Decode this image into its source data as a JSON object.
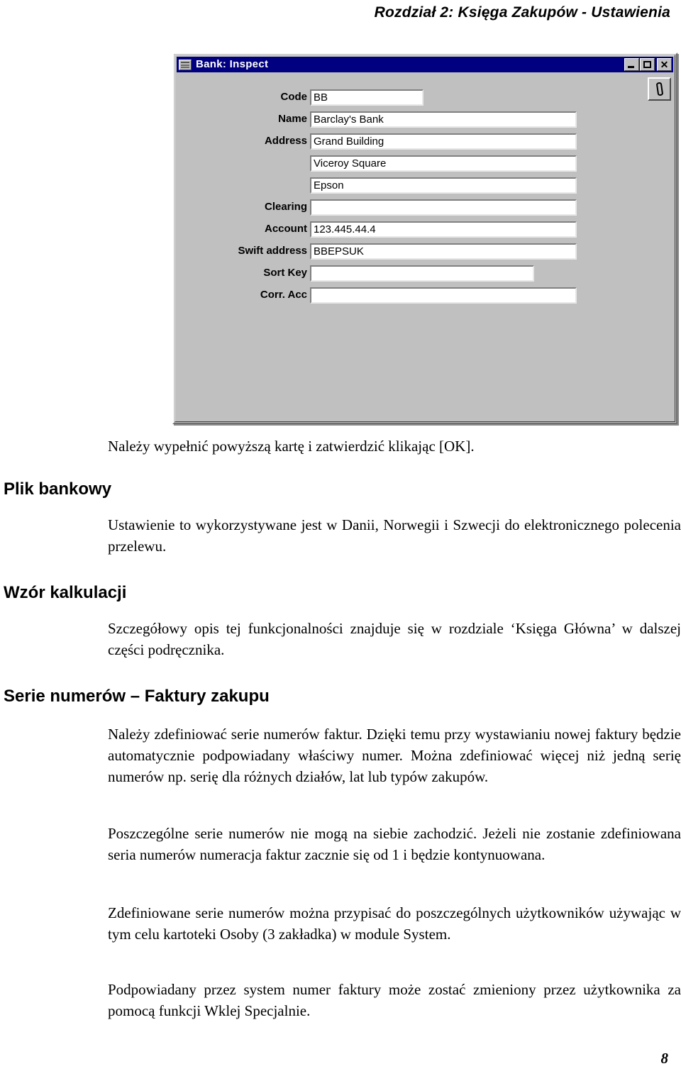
{
  "header": {
    "running_title": "Rozdział 2: Księga Zakupów - Ustawienia"
  },
  "dialog": {
    "title": "Bank: Inspect",
    "title_icon": "window-document-icon",
    "window_buttons": {
      "minimize": "_",
      "maximize": "□",
      "close": "✕"
    },
    "attachment_button_icon": "paperclip-icon",
    "fields": [
      {
        "label": "Code",
        "value": "BB",
        "width": "code"
      },
      {
        "label": "Name",
        "value": "Barclay's Bank",
        "width": "full"
      },
      {
        "label": "Address",
        "value": "Grand Building",
        "width": "full"
      },
      {
        "label": "",
        "value": "Viceroy Square",
        "width": "full"
      },
      {
        "label": "",
        "value": "Epson",
        "width": "full"
      },
      {
        "label": "Clearing",
        "value": "",
        "width": "full"
      },
      {
        "label": "Account",
        "value": "123.445.44.4",
        "width": "full"
      },
      {
        "label": "Swift address",
        "value": "BBEPSUK",
        "width": "full"
      },
      {
        "label": "Sort Key",
        "value": "",
        "width": "sort"
      },
      {
        "label": "Corr. Acc",
        "value": "",
        "width": "full"
      }
    ]
  },
  "content": {
    "caption": "Należy wypełnić powyższą kartę i zatwierdzić klikając [OK].",
    "section1_heading": "Plik bankowy",
    "section1_text": "Ustawienie to wykorzystywane jest w Danii, Norwegii i Szwecji do elektronicznego polecenia przelewu.",
    "section2_heading": "Wzór kalkulacji",
    "section2_text": "Szczegółowy opis tej funkcjonalności znajduje się w rozdziale ‘Księga Główna’ w dalszej części podręcznika.",
    "section3_heading": "Serie numerów – Faktury zakupu",
    "section3_p1": "Należy zdefiniować serie numerów faktur. Dzięki temu przy wystawianiu nowej faktury będzie automatycznie podpowiadany właściwy numer. Można zdefiniować więcej niż jedną serię numerów np. serię dla różnych działów, lat lub typów zakupów.",
    "section3_p2": "Poszczególne serie numerów nie mogą na siebie zachodzić. Jeżeli nie zostanie zdefiniowana seria numerów numeracja faktur zacznie się od 1 i będzie kontynuowana.",
    "section3_p3": "Zdefiniowane serie numerów można przypisać do poszczególnych użytkowników używając w tym celu kartoteki Osoby (3 zakładka) w module System.",
    "section3_p4": "Podpowiadany przez system numer faktury może zostać zmieniony przez użytkownika za pomocą funkcji Wklej Specjalnie."
  },
  "footer": {
    "page_number": "8"
  }
}
